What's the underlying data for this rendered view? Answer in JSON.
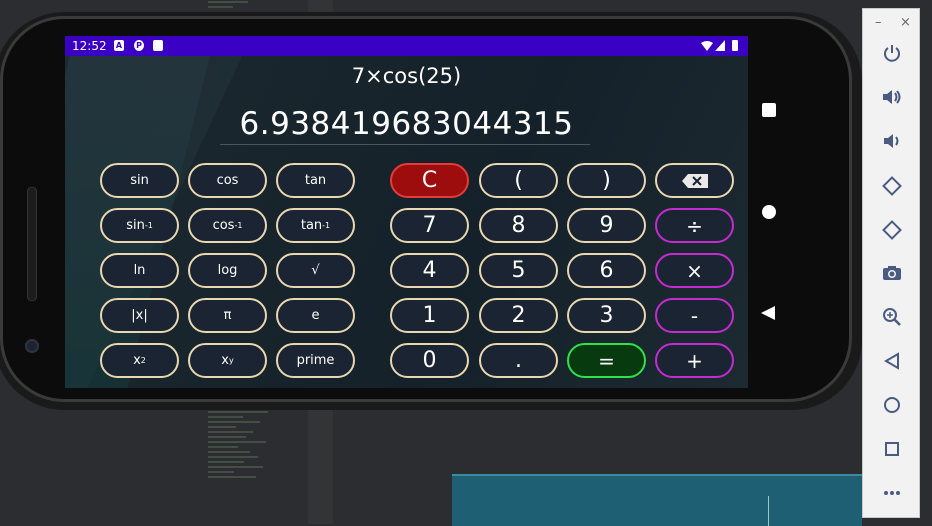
{
  "status_bar": {
    "time": "12:52",
    "icons": [
      "a-icon",
      "p-icon",
      "sd-card-icon"
    ],
    "right_icons": "▾◢▮"
  },
  "display": {
    "expression": "7×cos(25)",
    "result": "6.938419683044315"
  },
  "scientific_buttons": [
    {
      "label": "sin",
      "sup": ""
    },
    {
      "label": "cos",
      "sup": ""
    },
    {
      "label": "tan",
      "sup": ""
    },
    {
      "label": "sin",
      "sup": "-1"
    },
    {
      "label": "cos",
      "sup": "-1"
    },
    {
      "label": "tan",
      "sup": "-1"
    },
    {
      "label": "ln",
      "sup": ""
    },
    {
      "label": "log",
      "sup": ""
    },
    {
      "label": "√",
      "sup": ""
    },
    {
      "label": "|x|",
      "sup": ""
    },
    {
      "label": "π",
      "sup": ""
    },
    {
      "label": "e",
      "sup": ""
    },
    {
      "label": "x",
      "sup": "2"
    },
    {
      "label": "x",
      "sup": "y"
    },
    {
      "label": "prime",
      "sup": ""
    }
  ],
  "keypad": {
    "clear": "C",
    "open_paren": "(",
    "close_paren": ")",
    "backspace_icon": "backspace-icon",
    "digits": [
      "7",
      "8",
      "9",
      "4",
      "5",
      "6",
      "1",
      "2",
      "3",
      "0"
    ],
    "dot": ".",
    "equals": "=",
    "divide": "÷",
    "multiply": "×",
    "minus": "-",
    "plus": "+"
  },
  "emulator_toolbar": {
    "minimize": "–",
    "close": "×",
    "tools": [
      "power-icon",
      "volume-up-icon",
      "volume-down-icon",
      "rotate-left-icon",
      "rotate-right-icon",
      "camera-icon",
      "zoom-icon",
      "back-icon",
      "home-icon",
      "overview-icon",
      "more-icon"
    ]
  },
  "colors": {
    "status_bar": "#3a00c4",
    "clear_button": "#9e0d0d",
    "equals_button": "#083a10",
    "operator_border": "#c42bd1",
    "button_border": "#e8d7b0"
  }
}
